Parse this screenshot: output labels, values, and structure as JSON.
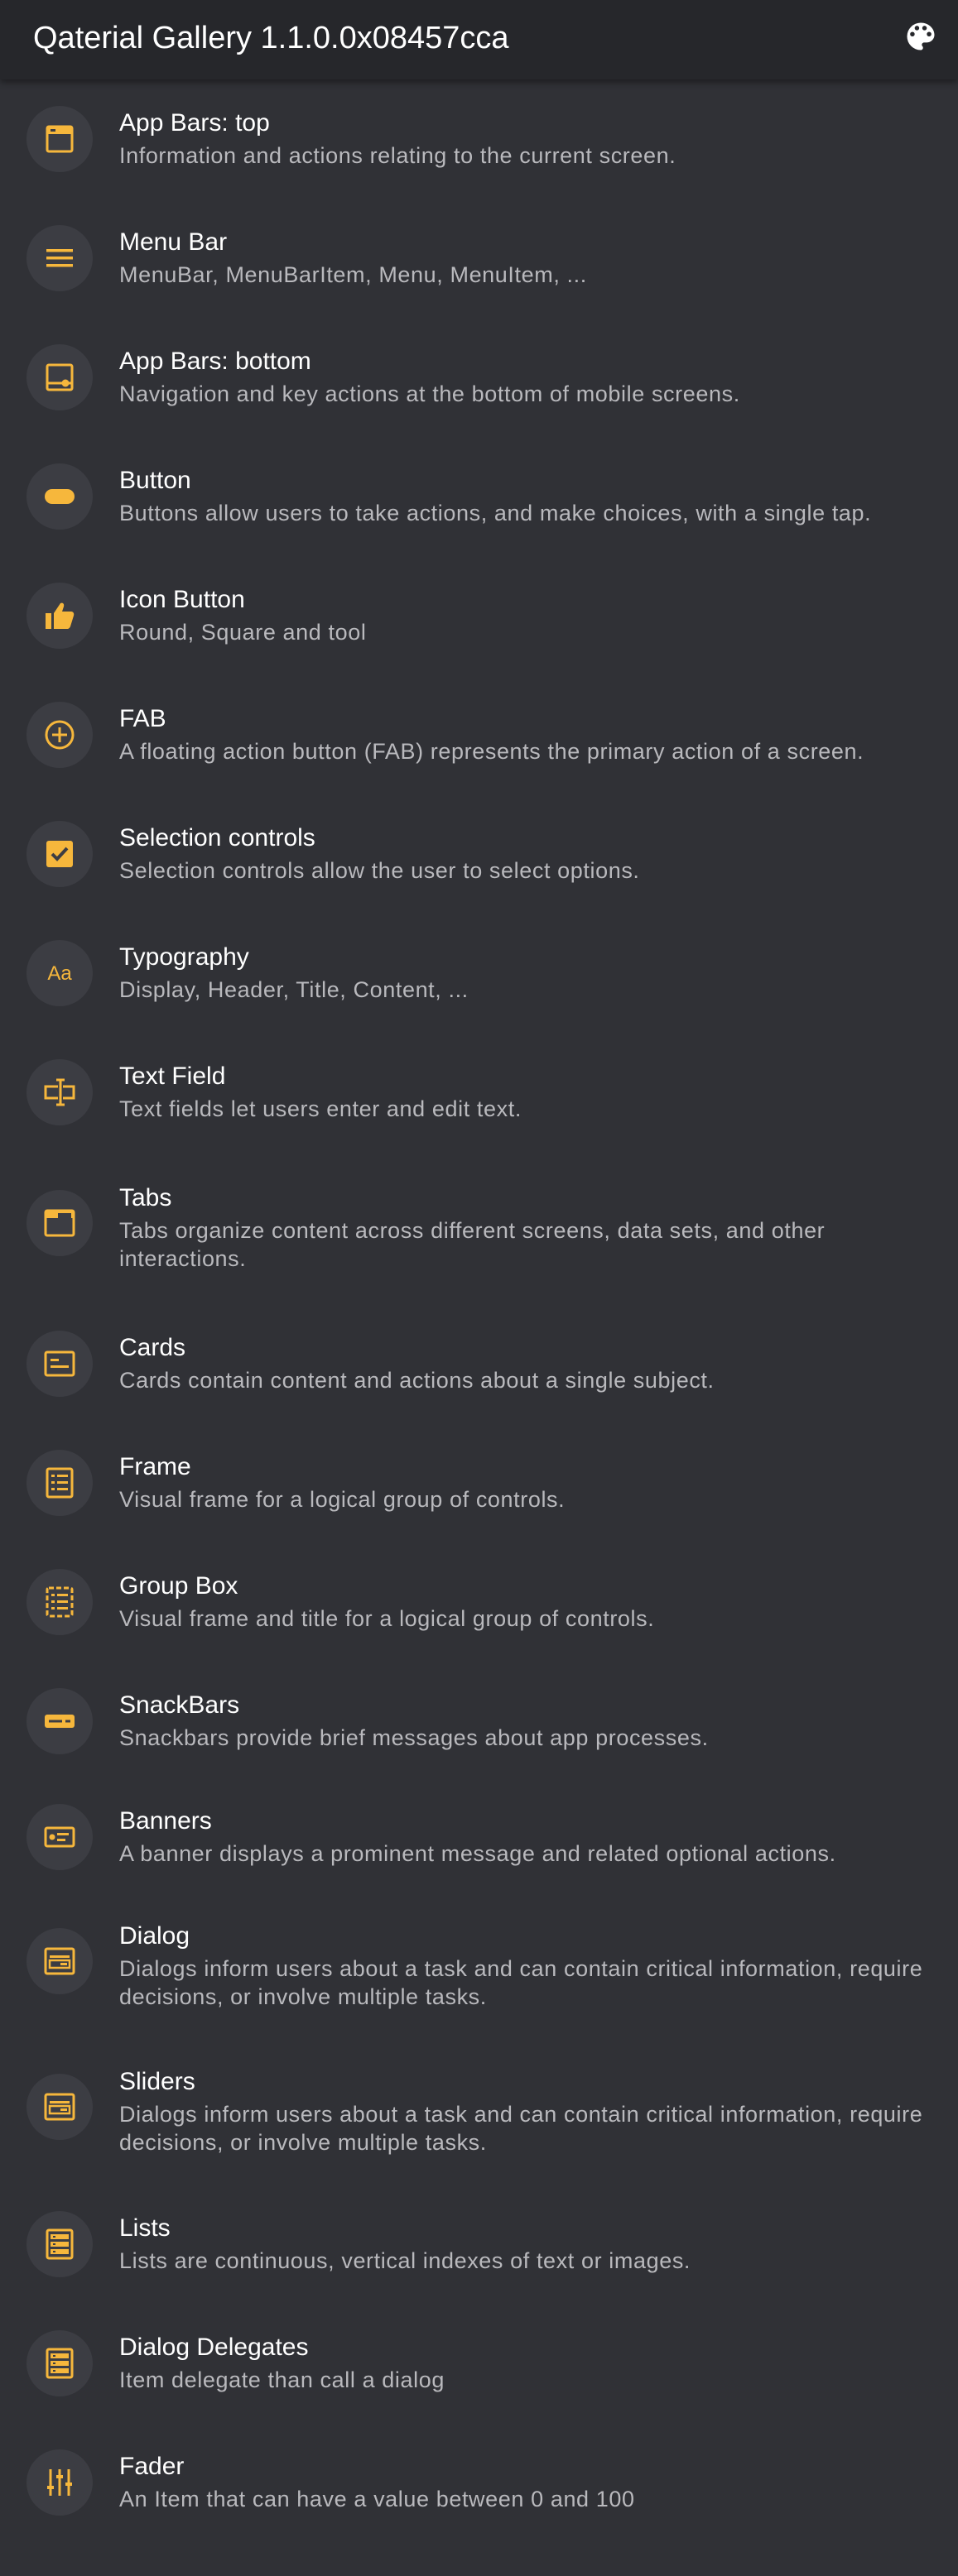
{
  "app": {
    "title": "Qaterial Gallery 1.1.0.0x08457cca",
    "accent_color": "#f6b73c",
    "background_color": "#303136",
    "appbar_color": "#26272b",
    "theme_button_icon": "palette-icon"
  },
  "items": [
    {
      "label": "App Bars: top",
      "description": "Information and actions relating to the current screen.",
      "icon": "app-bar-top-icon"
    },
    {
      "label": "Menu Bar",
      "description": "MenuBar, MenuBarItem, Menu, MenuItem, ...",
      "icon": "menu-icon"
    },
    {
      "label": "App Bars: bottom",
      "description": "Navigation and key actions at the bottom of mobile screens.",
      "icon": "app-bar-bottom-icon"
    },
    {
      "label": "Button",
      "description": "Buttons allow users to take actions, and make choices, with a single tap.",
      "icon": "button-icon"
    },
    {
      "label": "Icon Button",
      "description": "Round, Square and tool",
      "icon": "thumb-up-icon"
    },
    {
      "label": "FAB",
      "description": "A floating action button (FAB) represents the primary action of a screen.",
      "icon": "plus-circle-icon"
    },
    {
      "label": "Selection controls",
      "description": "Selection controls allow the user to select options.",
      "icon": "checkbox-icon"
    },
    {
      "label": "Typography",
      "description": "Display, Header, Title, Content, ...",
      "icon": "typography-icon",
      "icon_text": "Aa"
    },
    {
      "label": "Text Field",
      "description": "Text fields let users enter and edit text.",
      "icon": "text-field-icon"
    },
    {
      "label": "Tabs",
      "description": "Tabs organize content across different screens, data sets, and other interactions.",
      "icon": "tab-icon"
    },
    {
      "label": "Cards",
      "description": "Cards contain content and actions about a single subject.",
      "icon": "card-icon"
    },
    {
      "label": "Frame",
      "description": "Visual frame for a logical group of controls.",
      "icon": "frame-icon"
    },
    {
      "label": "Group Box",
      "description": "Visual frame and title for a logical group of controls.",
      "icon": "group-box-icon"
    },
    {
      "label": "SnackBars",
      "description": "Snackbars provide brief messages about app processes.",
      "icon": "snackbar-icon"
    },
    {
      "label": "Banners",
      "description": "A banner displays a prominent message and related optional actions.",
      "icon": "banner-icon"
    },
    {
      "label": "Dialog",
      "description": "Dialogs inform users about a task and can contain critical information, require decisions, or involve multiple tasks.",
      "icon": "dialog-icon"
    },
    {
      "label": "Sliders",
      "description": "Dialogs inform users about a task and can contain critical information, require decisions, or involve multiple tasks.",
      "icon": "slider-icon"
    },
    {
      "label": "Lists",
      "description": "Lists are continuous, vertical indexes of text or images.",
      "icon": "list-icon"
    },
    {
      "label": "Dialog Delegates",
      "description": "Item delegate than call a dialog",
      "icon": "dialog-list-icon"
    },
    {
      "label": "Fader",
      "description": "An Item that can have a value between 0 and 100",
      "icon": "tune-icon"
    }
  ]
}
